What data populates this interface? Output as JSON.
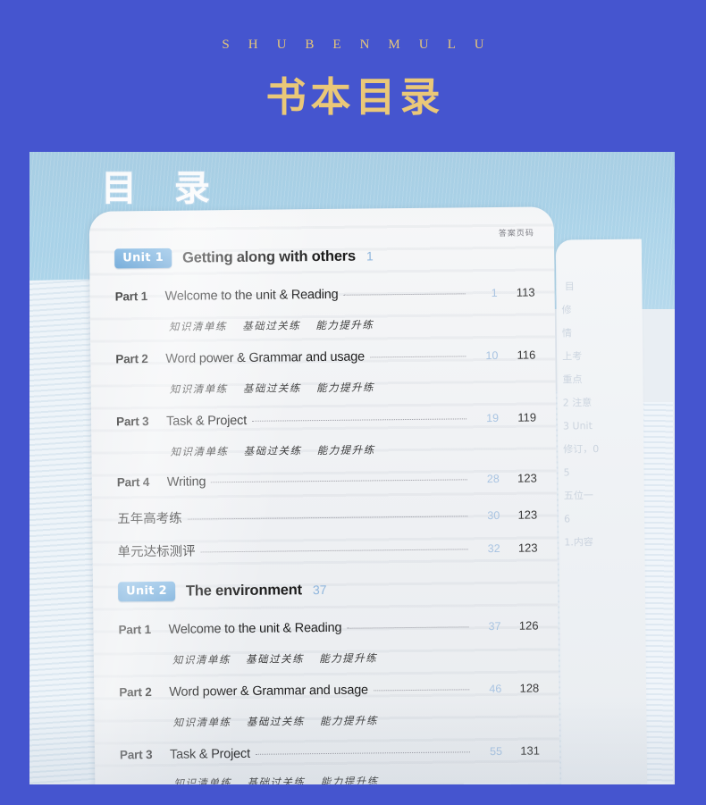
{
  "banner": {
    "pinyin": "SHUBENMULU",
    "title": "书本目录",
    "pinyin_color": "#e8c878",
    "title_color": "#eac878",
    "background_color": "#4555cf"
  },
  "book": {
    "cover_title": "目 录",
    "answer_column_header": "答案页码",
    "badge_color": "#6aa8dd",
    "page_number_color": "#a9c4e2",
    "answer_number_color": "#3a3a3a",
    "sub_items": [
      "知识清单练",
      "基础过关练",
      "能力提升练"
    ],
    "units": [
      {
        "badge": "Unit 1",
        "title": "Getting along with others",
        "page": "1",
        "rows": [
          {
            "label": "Part 1",
            "title": "Welcome to the unit & Reading",
            "page": "1",
            "answer": "113",
            "has_sub": true
          },
          {
            "label": "Part 2",
            "title": "Word power & Grammar and usage",
            "page": "10",
            "answer": "116",
            "has_sub": true
          },
          {
            "label": "Part 3",
            "title": "Task & Project",
            "page": "19",
            "answer": "119",
            "has_sub": true
          },
          {
            "label": "Part 4",
            "title": "Writing",
            "page": "28",
            "answer": "123",
            "has_sub": false
          },
          {
            "label": "",
            "title": "五年高考练",
            "page": "30",
            "answer": "123",
            "has_sub": false
          },
          {
            "label": "",
            "title": "单元达标测评",
            "page": "32",
            "answer": "123",
            "has_sub": false
          }
        ]
      },
      {
        "badge": "Unit 2",
        "title": "The environment",
        "page": "37",
        "rows": [
          {
            "label": "Part 1",
            "title": "Welcome to the unit & Reading",
            "page": "37",
            "answer": "126",
            "has_sub": true
          },
          {
            "label": "Part 2",
            "title": "Word power & Grammar and usage",
            "page": "46",
            "answer": "128",
            "has_sub": true
          },
          {
            "label": "Part 3",
            "title": "Task & Project",
            "page": "55",
            "answer": "131",
            "has_sub": true
          }
        ]
      }
    ]
  }
}
